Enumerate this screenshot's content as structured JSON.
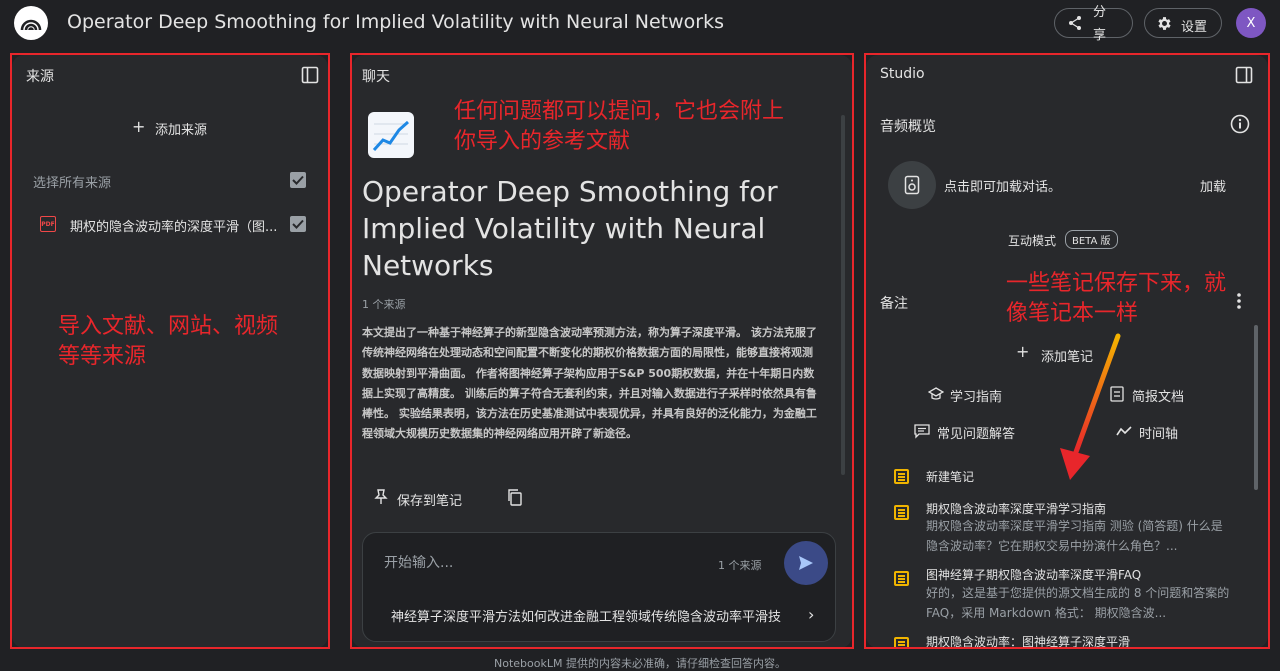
{
  "app": {
    "title": "Operator Deep Smoothing for Implied Volatility with Neural Networks",
    "share_label": "分享",
    "settings_label": "设置",
    "avatar_initial": "X"
  },
  "sources": {
    "header": "来源",
    "add_label": "添加来源",
    "select_all_label": "选择所有来源",
    "items": [
      {
        "icon": "pdf-icon",
        "label": "期权的隐含波动率的深度平滑（图...",
        "checked": true
      }
    ],
    "annotation": "导入文献、网站、视频等等来源"
  },
  "chat": {
    "header": "聊天",
    "annotation": "任何问题都可以提问，它也会附上你导入的参考文献",
    "doc_title": "Operator Deep Smoothing for Implied Volatility with Neural Networks",
    "source_count": "1 个来源",
    "summary": "本文提出了一种基于神经算子的新型隐含波动率预测方法，称为算子深度平滑。 该方法克服了传统神经网络在处理动态和空间配置不断变化的期权价格数据方面的局限性，能够直接将观测数据映射到平滑曲面。 作者将图神经算子架构应用于S&P 500期权数据，并在十年期日内数据上实现了高精度。 训练后的算子符合无套利约束，并且对输入数据进行子采样时依然具有鲁棒性。 实验结果表明，该方法在历史基准测试中表现优异，并具有良好的泛化能力，为金融工程领域大规模历史数据集的神经网络应用开辟了新途径。",
    "save_note_label": "保存到笔记",
    "input_placeholder": "开始输入...",
    "input_source_count": "1 个来源",
    "suggestion": "神经算子深度平滑方法如何改进金融工程领域传统隐含波动率平滑技术"
  },
  "studio": {
    "header": "Studio",
    "audio_title": "音频概览",
    "audio_text": "点击即可加载对话。",
    "load_label": "加载",
    "interactive_label": "互动模式",
    "beta_label": "BETA 版",
    "notes_title": "备注",
    "add_note_label": "添加笔记",
    "quick_actions": [
      {
        "icon": "graduation-cap-icon",
        "label": "学习指南"
      },
      {
        "icon": "briefing-doc-icon",
        "label": "简报文档"
      },
      {
        "icon": "faq-icon",
        "label": "常见问题解答"
      },
      {
        "icon": "timeline-icon",
        "label": "时间轴"
      }
    ],
    "notes": [
      {
        "title": "新建笔记",
        "body": ""
      },
      {
        "title": "期权隐含波动率深度平滑学习指南",
        "body": "期权隐含波动率深度平滑学习指南 测验 (简答题) 什么是隐含波动率？它在期权交易中扮演什么角色？..."
      },
      {
        "title": "图神经算子期权隐含波动率深度平滑FAQ",
        "body": "好的，这是基于您提供的源文档生成的 8 个问题和答案的 FAQ，采用 Markdown 格式： 期权隐含波..."
      },
      {
        "title": "期权隐含波动率：图神经算子深度平滑",
        "body": ""
      }
    ],
    "annotation": "一些笔记保存下来，就像笔记本一样"
  },
  "footer": "NotebookLM 提供的内容未必准确，请仔细检查回答内容。",
  "colors": {
    "annotation_red": "#e8262b",
    "note_icon": "#f0b400",
    "send_button": "#3b4a87",
    "avatar": "#7e57c2"
  }
}
